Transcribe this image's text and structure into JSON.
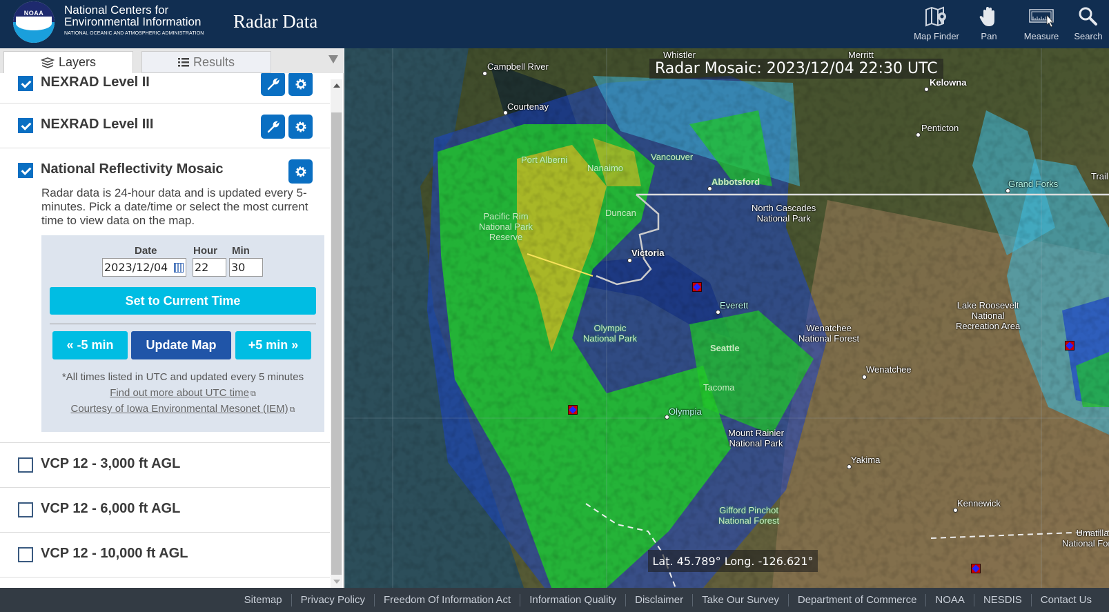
{
  "header": {
    "logo_text": "NOAA",
    "org_line1": "National Centers for",
    "org_line2": "Environmental Information",
    "org_line3": "NATIONAL OCEANIC AND ATMOSPHERIC ADMINISTRATION",
    "app_title": "Radar Data",
    "tools": [
      {
        "label": "Map Finder",
        "icon": "map-finder-icon"
      },
      {
        "label": "Pan",
        "icon": "hand-icon"
      },
      {
        "label": "Measure",
        "icon": "ruler-icon"
      },
      {
        "label": "Search",
        "icon": "search-icon"
      }
    ]
  },
  "panel": {
    "tabs": [
      {
        "label": "Layers",
        "icon": "layers-icon",
        "active": true
      },
      {
        "label": "Results",
        "icon": "list-icon",
        "active": false
      }
    ],
    "layers": [
      {
        "name": "NEXRAD Level II",
        "checked": true
      },
      {
        "name": "NEXRAD Level III",
        "checked": true
      },
      {
        "name": "National Reflectivity Mosaic",
        "checked": true
      },
      {
        "name": "VCP 12 - 3,000 ft AGL",
        "checked": false
      },
      {
        "name": "VCP 12 - 6,000 ft AGL",
        "checked": false
      },
      {
        "name": "VCP 12 - 10,000 ft AGL",
        "checked": false
      }
    ],
    "mosaic": {
      "description": "Radar data is 24-hour data and is updated every 5-minutes. Pick a date/time or select the most current time to view data on the map.",
      "date_label": "Date",
      "hour_label": "Hour",
      "min_label": "Min",
      "date_value": "2023/12/04",
      "hour_value": "22",
      "min_value": "30",
      "set_current_label": "Set to Current Time",
      "minus_label": "« -5 min",
      "update_label": "Update Map",
      "plus_label": "+5 min »",
      "note": "*All times listed in UTC and updated every 5 minutes",
      "utc_link": "Find out more about UTC time",
      "iem_link": "Courtesy of Iowa Environmental Mesonet (IEM)"
    }
  },
  "map": {
    "title": "Radar Mosaic: 2023/12/04 22:30 UTC",
    "coords": "Lat. 45.789°  Long. -126.621°",
    "places": [
      {
        "name": "Whistler"
      },
      {
        "name": "Merritt"
      },
      {
        "name": "Campbell River"
      },
      {
        "name": "Courtenay"
      },
      {
        "name": "Kelowna"
      },
      {
        "name": "Penticton"
      },
      {
        "name": "Port Alberni"
      },
      {
        "name": "Nanaimo"
      },
      {
        "name": "Vancouver"
      },
      {
        "name": "Abbotsford"
      },
      {
        "name": "Grand Forks"
      },
      {
        "name": "Trail"
      },
      {
        "name": "Duncan"
      },
      {
        "name": "North Cascades\nNational Park"
      },
      {
        "name": "Pacific Rim\nNational Park\nReserve"
      },
      {
        "name": "Victoria"
      },
      {
        "name": "Everett"
      },
      {
        "name": "Lake Roosevelt\nNational\nRecreation Area"
      },
      {
        "name": "Olympic\nNational Park"
      },
      {
        "name": "Wenatchee\nNational Forest"
      },
      {
        "name": "Seattle"
      },
      {
        "name": "Wenatchee"
      },
      {
        "name": "Tacoma"
      },
      {
        "name": "Olympia"
      },
      {
        "name": "Mount Rainier\nNational Park"
      },
      {
        "name": "Yakima"
      },
      {
        "name": "Gifford Pinchot\nNational Forest"
      },
      {
        "name": "Kennewick"
      },
      {
        "name": "Umatilla\nNational Forest"
      }
    ]
  },
  "footer": {
    "links": [
      "Sitemap",
      "Privacy Policy",
      "Freedom Of Information Act",
      "Information Quality",
      "Disclaimer",
      "Take Our Survey",
      "Department of Commerce",
      "NOAA",
      "NESDIS",
      "Contact Us"
    ]
  }
}
